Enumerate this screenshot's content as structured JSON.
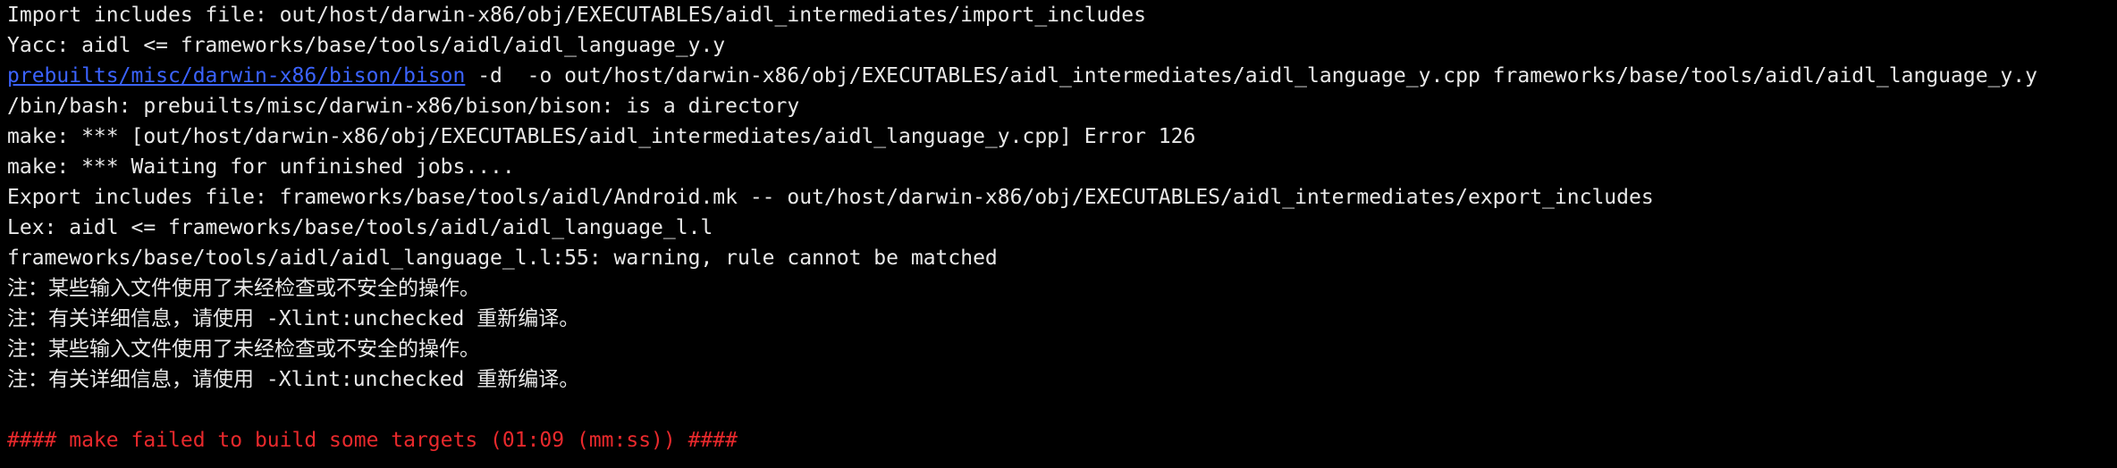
{
  "terminal": {
    "lines": [
      {
        "text": "Import includes file: out/host/darwin-x86/obj/EXECUTABLES/aidl_intermediates/import_includes"
      },
      {
        "text": "Yacc: aidl <= frameworks/base/tools/aidl/aidl_language_y.y"
      },
      {
        "link": "prebuilts/misc/darwin-x86/bison/bison",
        "text": " -d  -o out/host/darwin-x86/obj/EXECUTABLES/aidl_intermediates/aidl_language_y.cpp frameworks/base/tools/aidl/aidl_language_y.y"
      },
      {
        "text": "/bin/bash: prebuilts/misc/darwin-x86/bison/bison: is a directory"
      },
      {
        "text": "make: *** [out/host/darwin-x86/obj/EXECUTABLES/aidl_intermediates/aidl_language_y.cpp] Error 126"
      },
      {
        "text": "make: *** Waiting for unfinished jobs...."
      },
      {
        "text": "Export includes file: frameworks/base/tools/aidl/Android.mk -- out/host/darwin-x86/obj/EXECUTABLES/aidl_intermediates/export_includes"
      },
      {
        "text": "Lex: aidl <= frameworks/base/tools/aidl/aidl_language_l.l"
      },
      {
        "text": "frameworks/base/tools/aidl/aidl_language_l.l:55: warning, rule cannot be matched"
      },
      {
        "text": "注：某些输入文件使用了未经检查或不安全的操作。"
      },
      {
        "text": "注：有关详细信息，请使用 -Xlint:unchecked 重新编译。"
      },
      {
        "text": "注：某些输入文件使用了未经检查或不安全的操作。"
      },
      {
        "text": "注：有关详细信息，请使用 -Xlint:unchecked 重新编译。"
      },
      {
        "text": ""
      },
      {
        "text": "#### make failed to build some targets (01:09 (mm:ss)) ####"
      }
    ]
  },
  "colors": {
    "background": "#000000",
    "foreground": "#e8e8e8",
    "link": "#3b63ff",
    "error": "#e8292c"
  }
}
